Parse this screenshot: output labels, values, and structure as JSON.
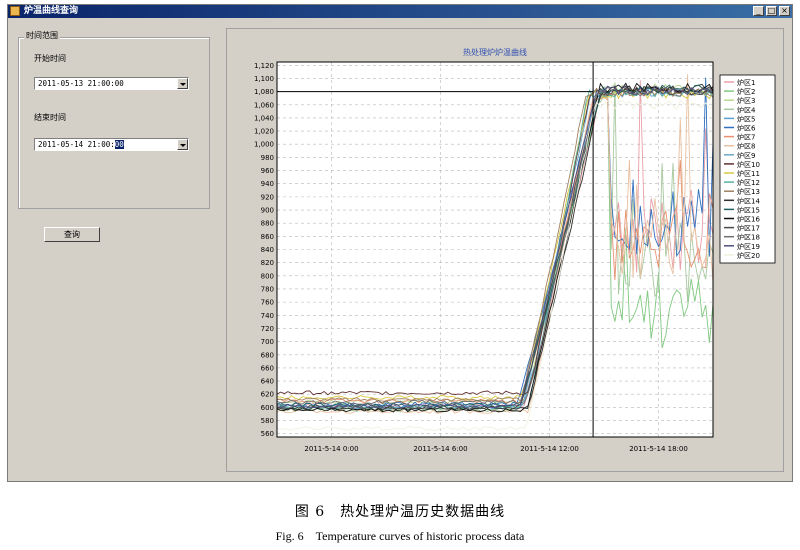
{
  "window": {
    "title": "炉温曲线查询",
    "controls": {
      "minimize": "_",
      "maximize": "□",
      "close": "×"
    }
  },
  "time_range": {
    "group_label": "时间范围",
    "start_label": "开始时间",
    "start_value": "2011-05-13 21:00:00",
    "end_label": "结束时间",
    "end_value_prefix": "2011-05-14 21:00:",
    "end_value_selected": "00"
  },
  "query_button": "查询",
  "caption": {
    "cn": "图 6　热处理炉温历史数据曲线",
    "en": "Fig. 6　Temperature curves of historic process data"
  },
  "chart_data": {
    "type": "line",
    "title": "热处理炉炉温曲线",
    "xlabel": "",
    "ylabel": "",
    "x_ticks": [
      "2011-5-14 0:00",
      "2011-5-14 6:00",
      "2011-5-14 12:00",
      "2011-5-14 18:00"
    ],
    "x_tick_hours": [
      3,
      9,
      15,
      21
    ],
    "xlim_hours": [
      0,
      24
    ],
    "ylim": [
      555,
      1125
    ],
    "y_ticks": [
      560,
      580,
      600,
      620,
      640,
      660,
      680,
      700,
      720,
      740,
      760,
      780,
      800,
      820,
      840,
      860,
      880,
      900,
      920,
      940,
      960,
      980,
      1000,
      1020,
      1040,
      1060,
      1080,
      1100,
      1120
    ],
    "setpoint_line": 1080,
    "vertical_marker_hour": 17.4,
    "grid": true,
    "legend_position": "right",
    "series": [
      {
        "name": "炉区1",
        "color": "#e8a0a8",
        "low": 603,
        "high": 1075,
        "tail": 860
      },
      {
        "name": "炉区2",
        "color": "#80c880",
        "low": 598,
        "high": 1072,
        "tail": 750
      },
      {
        "name": "炉区3",
        "color": "#b8d890",
        "low": 608,
        "high": 1085,
        "tail": 1080
      },
      {
        "name": "炉区4",
        "color": "#a8c8a0",
        "low": 596,
        "high": 1070,
        "tail": 820
      },
      {
        "name": "炉区5",
        "color": "#5aa0d0",
        "low": 600,
        "high": 1078,
        "tail": 1070
      },
      {
        "name": "炉区6",
        "color": "#3070c0",
        "low": 605,
        "high": 1072,
        "tail": 880
      },
      {
        "name": "炉区7",
        "color": "#e89070",
        "low": 610,
        "high": 1068,
        "tail": 845
      },
      {
        "name": "炉区8",
        "color": "#e8c0a0",
        "low": 594,
        "high": 1074,
        "tail": 830
      },
      {
        "name": "炉区9",
        "color": "#6aa8c8",
        "low": 602,
        "high": 1080,
        "tail": 1072
      },
      {
        "name": "炉区10",
        "color": "#603030",
        "low": 622,
        "high": 1082,
        "tail": 1075
      },
      {
        "name": "炉区11",
        "color": "#d8c840",
        "low": 615,
        "high": 1076,
        "tail": 1074
      },
      {
        "name": "炉区12",
        "color": "#58b0a0",
        "low": 600,
        "high": 1078,
        "tail": 1076
      },
      {
        "name": "炉区13",
        "color": "#a08060",
        "low": 612,
        "high": 1079,
        "tail": 1073
      },
      {
        "name": "炉区14",
        "color": "#303030",
        "low": 598,
        "high": 1084,
        "tail": 1078
      },
      {
        "name": "炉区15",
        "color": "#206060",
        "low": 604,
        "high": 1083,
        "tail": 1077
      },
      {
        "name": "炉区16",
        "color": "#101010",
        "low": 596,
        "high": 1086,
        "tail": 1079
      },
      {
        "name": "炉区17",
        "color": "#4a4a4a",
        "low": 600,
        "high": 1081,
        "tail": 1076
      },
      {
        "name": "炉区18",
        "color": "#707070",
        "low": 608,
        "high": 1080,
        "tail": 1074
      },
      {
        "name": "炉区19",
        "color": "#505080",
        "low": 602,
        "high": 1082,
        "tail": 1075
      },
      {
        "name": "炉区20",
        "color": "#f0f0e0",
        "low": 568,
        "high": 1060,
        "tail": 1050
      }
    ]
  }
}
